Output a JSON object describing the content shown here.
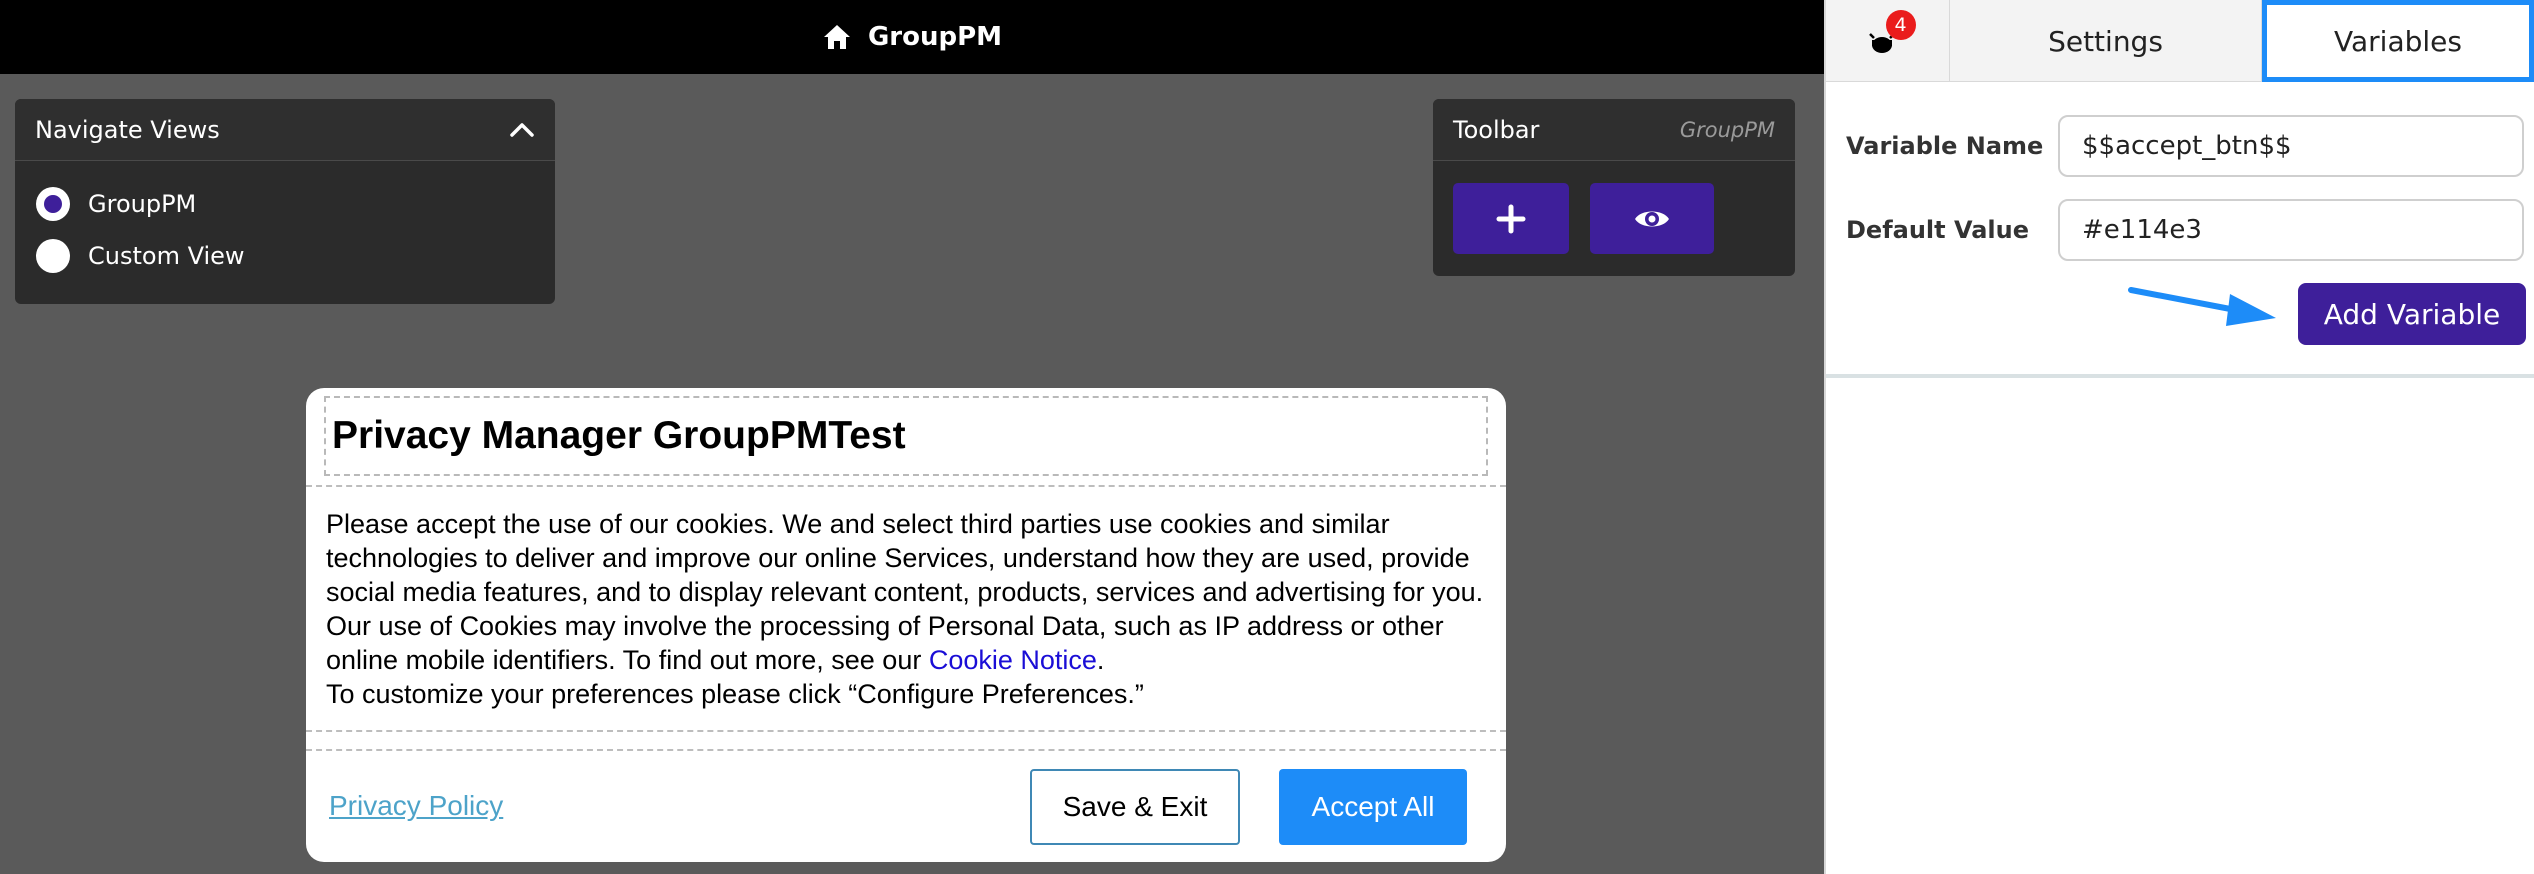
{
  "topbar": {
    "title": "GroupPM",
    "icon": "home-icon"
  },
  "nav_views": {
    "title": "Navigate Views",
    "options": [
      {
        "label": "GroupPM",
        "selected": true
      },
      {
        "label": "Custom View",
        "selected": false
      }
    ]
  },
  "toolbar": {
    "title": "Toolbar",
    "subtitle": "GroupPM",
    "buttons": [
      {
        "icon": "plus-icon"
      },
      {
        "icon": "eye-icon"
      }
    ]
  },
  "modal": {
    "title": "Privacy Manager GroupPMTest",
    "body_text": "Please accept the use of our cookies. We and select third parties use cookies and similar technologies to deliver and improve our online Services, understand how they are used, provide social media features, and to display relevant content, products, services and advertising for you. Our use of Cookies may involve the processing of Personal Data, such as IP address or other online mobile identifiers. To find out more, see our ",
    "cookie_link": "Cookie Notice",
    "body_tail": ".",
    "body_line2": "To customize your preferences please click “Configure Preferences.”",
    "privacy_link": "Privacy Policy",
    "save_label": "Save & Exit",
    "accept_label": "Accept All",
    "accent_color": "#1d8cf8"
  },
  "right_panel": {
    "tabs": {
      "bug_count": "4",
      "settings": "Settings",
      "variables": "Variables"
    },
    "form": {
      "name_label": "Variable Name",
      "name_value": "$$accept_btn$$",
      "default_label": "Default Value",
      "default_value": "#e114e3",
      "add_button": "Add Variable"
    }
  },
  "colors": {
    "primary_purple": "#3e1f9a",
    "selected_tab_border": "#1d8cf8",
    "badge_red": "#ea1c1c"
  }
}
